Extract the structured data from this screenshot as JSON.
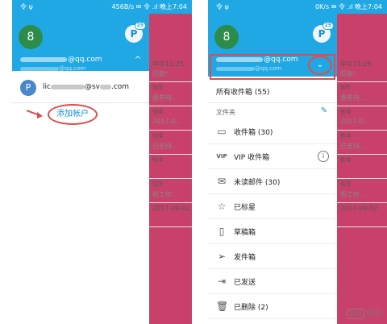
{
  "screens": [
    {
      "status_left": "令 ψ",
      "status_right": "456B/s ✉ 令 .ıl 晚上7:04",
      "header": {
        "avatar_num": "8",
        "avatar_p": "P",
        "badge": "25",
        "email_suffix": "@qq.com",
        "email2_suffix": "@qq.com",
        "chev_up": "^"
      },
      "account": {
        "avatar": "P",
        "prefix": "lic",
        "suffix": "@sv",
        "tld": ".com"
      },
      "add_account": "添加帐户",
      "bg_mail": [
        {
          "time": "中午11:25",
          "text": "回复!",
          "sub": "账的时"
        },
        {
          "time": "9/5",
          "text": "惠券待...",
          "sub": "量要投..."
        },
        {
          "time": "9/4",
          "text": "2017-0...",
          "sub": ""
        },
        {
          "time": "9/4",
          "text": "已支持...",
          "sub": "付现已..."
        },
        {
          "time": "9/4",
          "text": "",
          "sub": ""
        },
        {
          "time": "9/3",
          "text": "祝工作...",
          "sub": ""
        },
        {
          "time": "",
          "text": "2017-09-02...",
          "sub": ""
        }
      ]
    },
    {
      "status_left": "令 ψ",
      "status_right": "0K/s ✉ 令 .ıl 晚上7:04",
      "header": {
        "avatar_num": "8",
        "avatar_p": "P",
        "badge": "25",
        "email_suffix": "@qq.com",
        "email2_suffix": "@qq.com"
      },
      "all_inbox": "所有收件箱 (55)",
      "folder_section": "文件夹",
      "menu": [
        {
          "label": "收件箱 (30)",
          "icon": "inbox-icon"
        },
        {
          "label": "VIP 收件箱",
          "icon": "vip-icon"
        },
        {
          "label": "未读邮件 (30)",
          "icon": "unread-mail-icon"
        },
        {
          "label": "已标星",
          "icon": "star-icon"
        },
        {
          "label": "草稿箱",
          "icon": "draft-icon"
        },
        {
          "label": "发件箱",
          "icon": "outbox-icon"
        },
        {
          "label": "已发送",
          "icon": "sent-icon"
        },
        {
          "label": "已删除 (2)",
          "icon": "trash-icon"
        }
      ],
      "bg_mail": [
        {
          "time": "中午11:25",
          "text": "回复!",
          "sub": "账的时"
        },
        {
          "time": "9/5",
          "text": "惠券待...",
          "sub": "量要投..."
        },
        {
          "time": "9/4",
          "text": "2017-0...",
          "sub": ""
        },
        {
          "time": "9/4",
          "text": "已支持...",
          "sub": "付现已..."
        },
        {
          "time": "9/4",
          "text": "",
          "sub": ""
        },
        {
          "time": "9/3",
          "text": "祝工作...",
          "sub": ""
        },
        {
          "time": "",
          "text": "2017-09-02",
          "sub": ""
        }
      ]
    }
  ],
  "watermark": {
    "logo_text": "Bai",
    "text": "经验"
  }
}
